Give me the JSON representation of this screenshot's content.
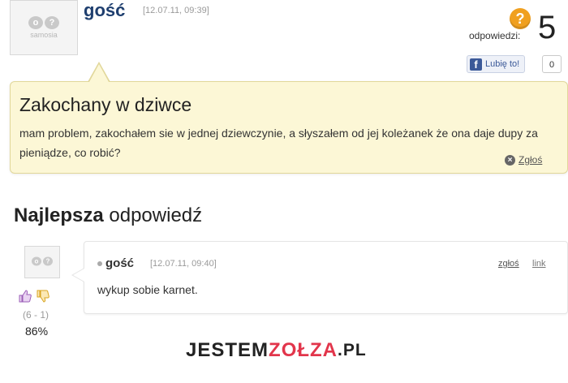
{
  "question": {
    "author": "gość",
    "date": "[12.07.11, 09:39]",
    "answers_label": "odpowiedzi:",
    "answers_count": "5",
    "like_label": "Lubię to!",
    "like_count": "0",
    "title": "Zakochany w dziwce",
    "body": "mam problem, zakochałem sie w jednej dziewczynie, a słyszałem od jej koleżanek że ona daje dupy za pieniądze, co robić?",
    "report_label": "Zgłoś"
  },
  "avatar": {
    "text": "samosia"
  },
  "best_answer": {
    "heading_bold": "Najlepsza",
    "heading_rest": "odpowiedź",
    "author": "gość",
    "date": "[12.07.11, 09:40]",
    "report_label": "zgłoś",
    "link_label": "link",
    "text": "wykup sobie karnet.",
    "vote_score": "(6 - 1)",
    "vote_percent": "86%"
  },
  "watermark": {
    "part1": "JESTEM",
    "part2": "ZOŁZA",
    "tld": ".PL"
  },
  "icons": {
    "question": "question-mark-icon",
    "facebook": "facebook-icon",
    "report": "close-circle-icon",
    "thumb_up": "thumbs-up-icon",
    "thumb_down": "thumbs-down-icon"
  },
  "colors": {
    "question_bg": "#fcf7d6",
    "author": "#1f3f6f",
    "accent_orange": "#f0a020",
    "watermark_red": "#e2354b"
  }
}
